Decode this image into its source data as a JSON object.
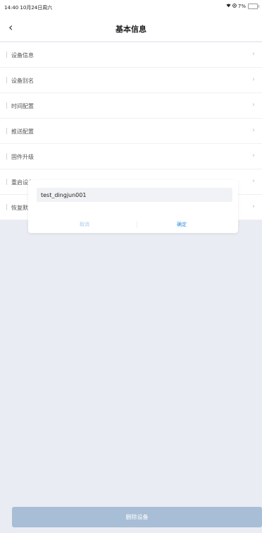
{
  "status": {
    "time": "14:40",
    "date": "10月24日周六",
    "battery": "7%"
  },
  "nav": {
    "back": "‹",
    "title": "基本信息"
  },
  "menu": [
    {
      "label": "设备信息"
    },
    {
      "label": "设备别名"
    },
    {
      "label": "时间配置"
    },
    {
      "label": "推送配置"
    },
    {
      "label": "固件升级"
    },
    {
      "label": "重启设备"
    },
    {
      "label": "恢复默认"
    }
  ],
  "dialog": {
    "input_value": "test_dingjun001",
    "cancel": "取消",
    "confirm": "确定"
  },
  "footer": {
    "delete": "删除设备"
  },
  "colors": {
    "accent": "#2f8ee0",
    "delete_bg": "#a8bed6",
    "page_bg": "#e9ecf2"
  }
}
